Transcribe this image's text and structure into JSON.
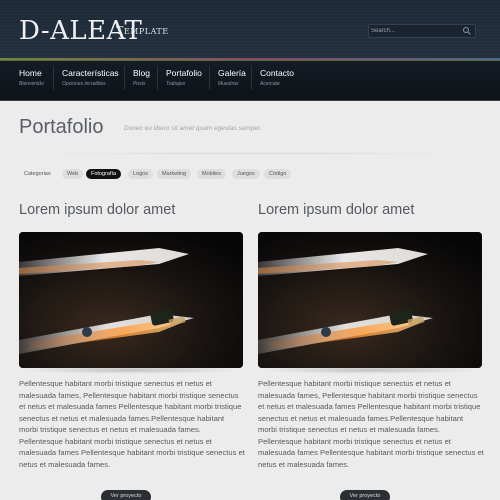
{
  "header": {
    "logo": "D-ALEAT",
    "logo_sub": "Template",
    "search_placeholder": "Search..."
  },
  "nav": [
    {
      "label": "Home",
      "sub": "Bienvenido"
    },
    {
      "label": "Características",
      "sub": "Opciones increibles"
    },
    {
      "label": "Blog",
      "sub": "Posts"
    },
    {
      "label": "Portafolio",
      "sub": "Trabajos"
    },
    {
      "label": "Galería",
      "sub": "Muestras"
    },
    {
      "label": "Contacto",
      "sub": "Acercate"
    }
  ],
  "page": {
    "title": "Portafolio",
    "tagline": "Donec eu libero sit amet quam egestas semper."
  },
  "filters": {
    "label": "Categorias",
    "items": [
      "Web",
      "Fotografía",
      "Logos",
      "Marketing",
      "Mobiles",
      "Juegos",
      "Código"
    ],
    "active": "Fotografía"
  },
  "posts": [
    {
      "title": "Lorem ipsum dolor amet",
      "body": "Pellentesque habitant morbi tristique senectus et netus et malesuada fames, Pellentesque habitant morbi tristique senectus et netus et malesuada fames Pellentesque habitant morbi tristique senectus et netus et malesuada fames.Pellentesque habitant morbi tristique senectus et netus et malesuada fames. Pellentesque habitant morbi tristique senectus et netus et malesuada fames Pellentesque habitant morbi tristique senectus et netus et malesuada fames.",
      "button": "Ver proyecto"
    },
    {
      "title": "Lorem ipsum dolor amet",
      "body": "Pellentesque habitant morbi tristique senectus et netus et malesuada fames, Pellentesque habitant morbi tristique senectus et netus et malesuada fames Pellentesque habitant morbi tristique senectus et netus et malesuada fames.Pellentesque habitant morbi tristique senectus et netus et malesuada fames. Pellentesque habitant morbi tristique senectus et netus et malesuada fames Pellentesque habitant morbi tristique senectus et netus et malesuada fames.",
      "button": "Ver proyecto"
    }
  ],
  "colors": {
    "header_bg": "#1e2b39",
    "nav_bg": "#11171e",
    "active_filter": "#111111"
  }
}
